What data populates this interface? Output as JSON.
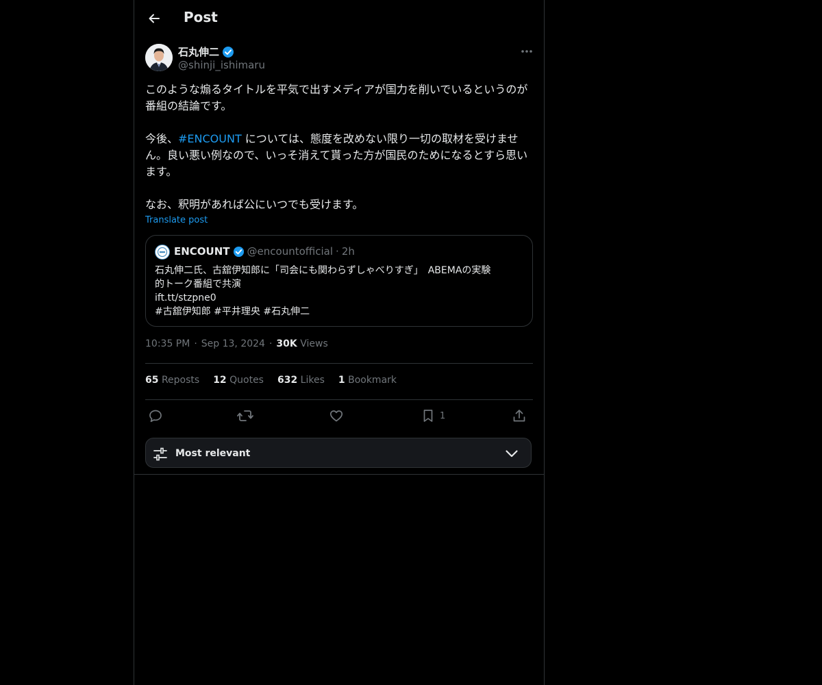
{
  "header": {
    "title": "Post"
  },
  "post": {
    "author_name": "石丸伸二",
    "author_handle": "@shinji_ishimaru",
    "text_p1": "このような煽るタイトルを平気で出すメディアが国力を削いでいるというのが番組の結論です。",
    "text_p2_before": "今後、",
    "text_p2_hashtag": "#ENCOUNT",
    "text_p2_after": " については、態度を改めない限り一切の取材を受けません。良い悪い例なので、いっそ消えて貰った方が国民のためになるとすら思います。",
    "text_p3": "なお、釈明があれば公にいつでも受けます。",
    "translate_label": "Translate post"
  },
  "quote": {
    "name": "ENCOUNT",
    "handle": "@encountofficial",
    "separator": "·",
    "time": "2h",
    "line1": "石丸伸二氏、古舘伊知郎に「司会にも関わらずしゃべりすぎ」　ABEMAの実験",
    "line2": "的トーク番組で共演",
    "line3": "ift.tt/stzpne0",
    "line4": "#古舘伊知郎 #平井理央 #石丸伸二"
  },
  "meta": {
    "time": "10:35 PM",
    "separator": "·",
    "date": "Sep 13, 2024",
    "views_count": "30K",
    "views_label": "Views"
  },
  "stats": {
    "reposts_count": "65",
    "reposts_label": "Reposts",
    "quotes_count": "12",
    "quotes_label": "Quotes",
    "likes_count": "632",
    "likes_label": "Likes",
    "bookmarks_count": "1",
    "bookmarks_label": "Bookmark"
  },
  "actions": {
    "bookmark_count": "1"
  },
  "sort": {
    "label": "Most relevant"
  },
  "colors": {
    "accent": "#1d9bf0",
    "muted": "#71767b",
    "border": "#2f3336",
    "text": "#e7e9ea",
    "background": "#000000"
  }
}
